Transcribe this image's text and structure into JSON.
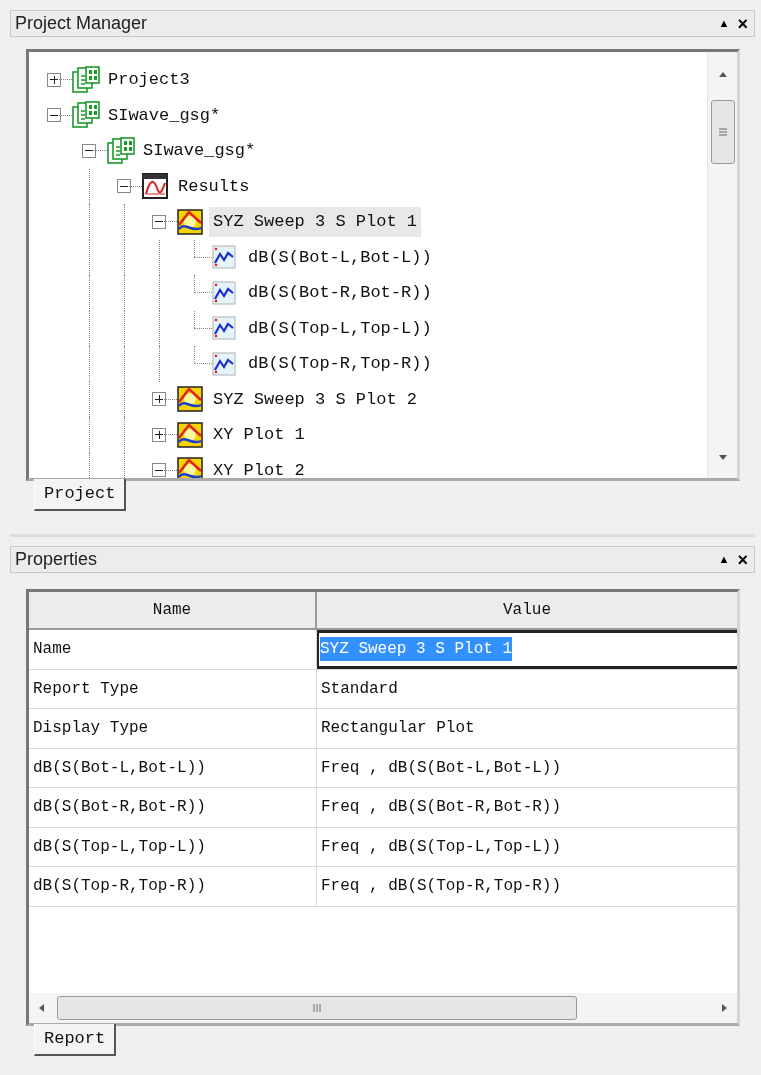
{
  "project_manager": {
    "title": "Project Manager",
    "title_buttons": [
      "▲",
      "×"
    ],
    "tree": [
      {
        "label": "Project3",
        "kind": "project",
        "expanded": false,
        "selected": false
      },
      {
        "label": "SIwave_gsg*",
        "kind": "project",
        "expanded": true,
        "selected": false,
        "children": [
          {
            "label": "SIwave_gsg*",
            "kind": "design",
            "expanded": true,
            "selected": false,
            "children": [
              {
                "label": "Results",
                "kind": "results",
                "expanded": true,
                "selected": false,
                "children": [
                  {
                    "label": "SYZ Sweep 3 S Plot 1",
                    "kind": "plot",
                    "expanded": true,
                    "selected": true,
                    "children": [
                      {
                        "label": "dB(S(Bot-L,Bot-L))",
                        "kind": "trace",
                        "selected": false
                      },
                      {
                        "label": "dB(S(Bot-R,Bot-R))",
                        "kind": "trace",
                        "selected": false
                      },
                      {
                        "label": "dB(S(Top-L,Top-L))",
                        "kind": "trace",
                        "selected": false
                      },
                      {
                        "label": "dB(S(Top-R,Top-R))",
                        "kind": "trace",
                        "selected": false
                      }
                    ]
                  },
                  {
                    "label": "SYZ Sweep 3 S Plot 2",
                    "kind": "plot",
                    "expanded": false,
                    "selected": false
                  },
                  {
                    "label": "XY Plot 1",
                    "kind": "plot",
                    "expanded": false,
                    "selected": false
                  },
                  {
                    "label": "XY Plot 2",
                    "kind": "plot",
                    "expanded": true,
                    "selected": false
                  }
                ]
              }
            ]
          }
        ]
      }
    ],
    "tabs": [
      {
        "label": "Project",
        "selected": true
      }
    ]
  },
  "properties": {
    "title": "Properties",
    "title_buttons": [
      "▲",
      "×"
    ],
    "columns": [
      "Name",
      "Value"
    ],
    "rows": [
      {
        "name": "Name",
        "value": "SYZ Sweep 3 S Plot 1",
        "editing": true
      },
      {
        "name": "Report Type",
        "value": "Standard",
        "editing": false
      },
      {
        "name": "Display Type",
        "value": "Rectangular Plot",
        "editing": false
      },
      {
        "name": "dB(S(Bot-L,Bot-L))",
        "value": "Freq , dB(S(Bot-L,Bot-L))",
        "editing": false
      },
      {
        "name": "dB(S(Bot-R,Bot-R))",
        "value": "Freq , dB(S(Bot-R,Bot-R))",
        "editing": false
      },
      {
        "name": "dB(S(Top-L,Top-L))",
        "value": "Freq , dB(S(Top-L,Top-L))",
        "editing": false
      },
      {
        "name": "dB(S(Top-R,Top-R))",
        "value": "Freq , dB(S(Top-R,Top-R))",
        "editing": false
      }
    ],
    "tabs": [
      {
        "label": "Report",
        "selected": true
      }
    ]
  }
}
